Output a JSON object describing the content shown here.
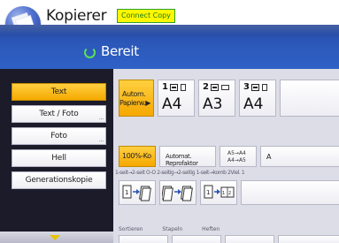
{
  "header": {
    "app_icon": "copier-icon",
    "title": "Kopierer",
    "badge": "Connect Copy"
  },
  "status": {
    "icon": "ready-ring-icon",
    "text": "Bereit",
    "icon_color": "#5ae05a"
  },
  "modes": {
    "items": [
      {
        "label": "Text",
        "active": true
      },
      {
        "label": "Text / Foto",
        "active": false
      },
      {
        "label": "Foto",
        "active": false
      },
      {
        "label": "Hell",
        "active": false
      },
      {
        "label": "Generationskopie",
        "active": false
      }
    ]
  },
  "paper": {
    "auto_line1": "Autom.",
    "auto_line2": "Papierw.▶",
    "trays": [
      {
        "number": "1",
        "size": "A4"
      },
      {
        "number": "2",
        "size": "A3"
      },
      {
        "number": "3",
        "size": "A4"
      }
    ]
  },
  "reduce": {
    "percent": "100%-Ko",
    "auto_factor": "Automat. Reprofaktor",
    "a5a4_line1": "A5→A4",
    "a5a4_line2": "A4→A5",
    "more": "A"
  },
  "duplex": {
    "labels": "1-seit→2-seit O-O  2-seitig→2-seitig  1-seit→komb  2Viel. 1"
  },
  "bottom": {
    "labels": [
      "Sortieren",
      "Stapeln",
      "Heften"
    ]
  },
  "colors": {
    "accent": "#f5a800",
    "status_bar": "#2b56b8",
    "left_panel": "#1b1b2a",
    "badge_bg": "#fff700"
  }
}
